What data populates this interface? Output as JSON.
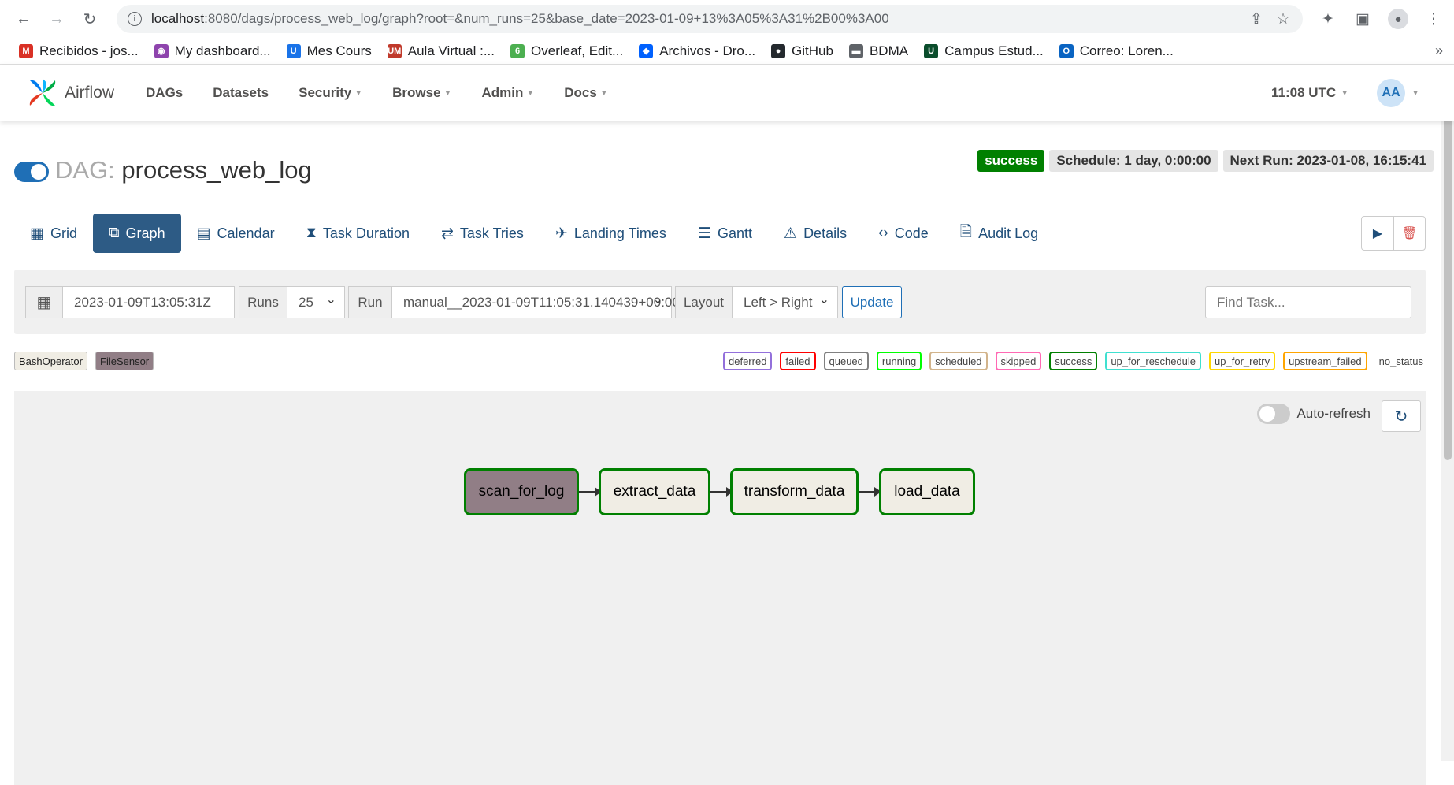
{
  "browser": {
    "url_host": "localhost",
    "url_path": ":8080/dags/process_web_log/graph?root=&num_runs=25&base_date=2023-01-09+13%3A05%3A31%2B00%3A00",
    "bookmarks": [
      {
        "label": "Recibidos - jos...",
        "color": "#d93025",
        "glyph": "M"
      },
      {
        "label": "My dashboard...",
        "color": "#8e44ad",
        "glyph": "◉"
      },
      {
        "label": "Mes Cours",
        "color": "#1a73e8",
        "glyph": "U"
      },
      {
        "label": "Aula Virtual :...",
        "color": "#c0392b",
        "glyph": "UM"
      },
      {
        "label": "Overleaf, Edit...",
        "color": "#4caf50",
        "glyph": "6"
      },
      {
        "label": "Archivos - Dro...",
        "color": "#0061fe",
        "glyph": "◆"
      },
      {
        "label": "GitHub",
        "color": "#24292e",
        "glyph": "●"
      },
      {
        "label": "BDMA",
        "color": "#5f6368",
        "glyph": "▬"
      },
      {
        "label": "Campus Estud...",
        "color": "#0b4d2c",
        "glyph": "U"
      },
      {
        "label": "Correo: Loren...",
        "color": "#0a64c2",
        "glyph": "O"
      }
    ]
  },
  "navbar": {
    "brand": "Airflow",
    "menu": [
      "DAGs",
      "Datasets",
      "Security",
      "Browse",
      "Admin",
      "Docs"
    ],
    "clock": "11:08 UTC",
    "avatar": "AA"
  },
  "dag": {
    "label": "DAG:",
    "name": "process_web_log",
    "status": "success",
    "schedule": "Schedule: 1 day, 0:00:00",
    "next_run": "Next Run: 2023-01-08, 16:15:41"
  },
  "tabs": [
    "Grid",
    "Graph",
    "Calendar",
    "Task Duration",
    "Task Tries",
    "Landing Times",
    "Gantt",
    "Details",
    "Code",
    "Audit Log"
  ],
  "filters": {
    "base_date": "2023-01-09T13:05:31Z",
    "runs_label": "Runs",
    "runs_value": "25",
    "run_label": "Run",
    "run_value": "manual__2023-01-09T11:05:31.140439+00:00",
    "layout_label": "Layout",
    "layout_value": "Left > Right",
    "update_label": "Update",
    "find_placeholder": "Find Task..."
  },
  "operators": [
    "BashOperator",
    "FileSensor"
  ],
  "states": [
    {
      "label": "deferred",
      "color": "#9370db"
    },
    {
      "label": "failed",
      "color": "#ff0000"
    },
    {
      "label": "queued",
      "color": "#808080"
    },
    {
      "label": "running",
      "color": "#00ff00"
    },
    {
      "label": "scheduled",
      "color": "#d2b48c"
    },
    {
      "label": "skipped",
      "color": "#ff69b4"
    },
    {
      "label": "success",
      "color": "#008000"
    },
    {
      "label": "up_for_reschedule",
      "color": "#40e0d0"
    },
    {
      "label": "up_for_retry",
      "color": "#ffd700"
    },
    {
      "label": "upstream_failed",
      "color": "#ffa500"
    },
    {
      "label": "no_status",
      "color": ""
    }
  ],
  "graph": {
    "auto_refresh": "Auto-refresh",
    "tasks": [
      "scan_for_log",
      "extract_data",
      "transform_data",
      "load_data"
    ]
  }
}
